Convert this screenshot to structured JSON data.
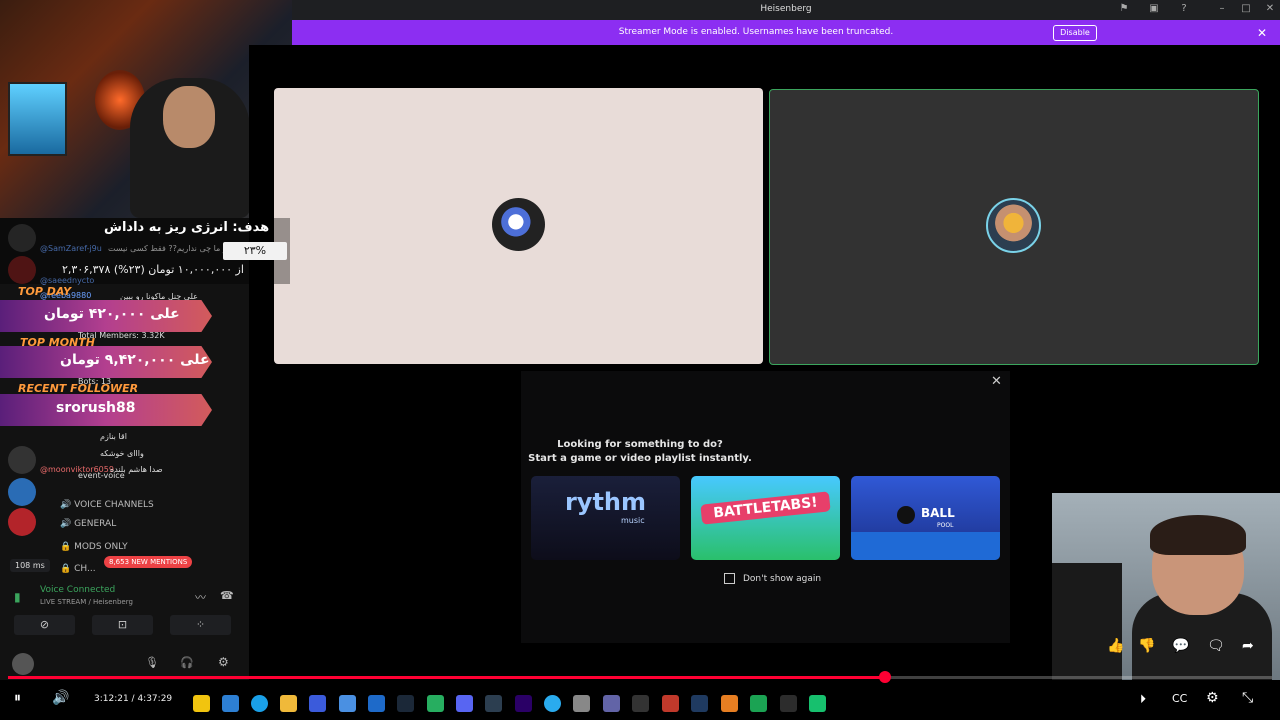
{
  "window": {
    "title": "Heisenberg",
    "icons": [
      "pin-icon",
      "screen-icon",
      "help-icon",
      "minimize-icon",
      "maximize-icon",
      "close-icon"
    ]
  },
  "banner": {
    "text": "Streamer Mode is enabled. Usernames have been truncated.",
    "button": "Disable",
    "close": "✕"
  },
  "popup": {
    "close": "✕",
    "line1": "Looking for something to do?",
    "line2": "Start a game or video playlist instantly.",
    "cards": [
      {
        "title": "rythm",
        "sub": "music"
      },
      {
        "title": "BATTLETABS!"
      },
      {
        "title": "BALL",
        "sub": "POOL"
      }
    ],
    "dont_show": "Don't show again"
  },
  "overlay": {
    "goal_title": "هدف: انرژی ریز به داداش",
    "goal_percent": "۲۳%",
    "goal_amount": "۲,۳۰۶,۳۷۸ از ۱۰,۰۰۰,۰۰۰ تومان (۲۳%)",
    "top_day_label": "TOP DAY",
    "top_day_value": "علی ۴۲۰,۰۰۰ تومان",
    "top_month_label": "TOP MONTH",
    "top_month_value": "علی ۹,۴۲۰,۰۰۰ تومان",
    "recent_follower_label": "RECENT FOLLOWER",
    "recent_follower_value": "srorush88"
  },
  "chat": {
    "lines": [
      "@SamZaref-j9u",
      "@saeednycto",
      "@reeba9880",
      "@moonviktor6059"
    ],
    "messages": [
      "بیز ما چی نداریم?? فقط کسی نیست",
      "علی چنل ماکونا رو ببین",
      "اقا بنازم",
      "وااای خوشکه",
      "صدا هاشم بلنده"
    ]
  },
  "channels": {
    "voice_header": "VOICE CHANNELS",
    "items": [
      "GENERAL",
      "MODS ONLY",
      "CH..."
    ],
    "event_voice": "event-voice",
    "total_members": "Total Members: 3.32K",
    "bots": "Bots: 13"
  },
  "status": {
    "ping": "108 ms",
    "mentions": "8,653 NEW MENTIONS",
    "voice_connected": "Voice Connected",
    "voice_sub": "LIVE STREAM / Heisenberg"
  },
  "player": {
    "time": "3:12:21 / 4:37:29",
    "progress": 0.694
  },
  "colors": {
    "banner": "#8c2ef2",
    "progress": "#ff0033",
    "speaking": "#3ba55d"
  }
}
